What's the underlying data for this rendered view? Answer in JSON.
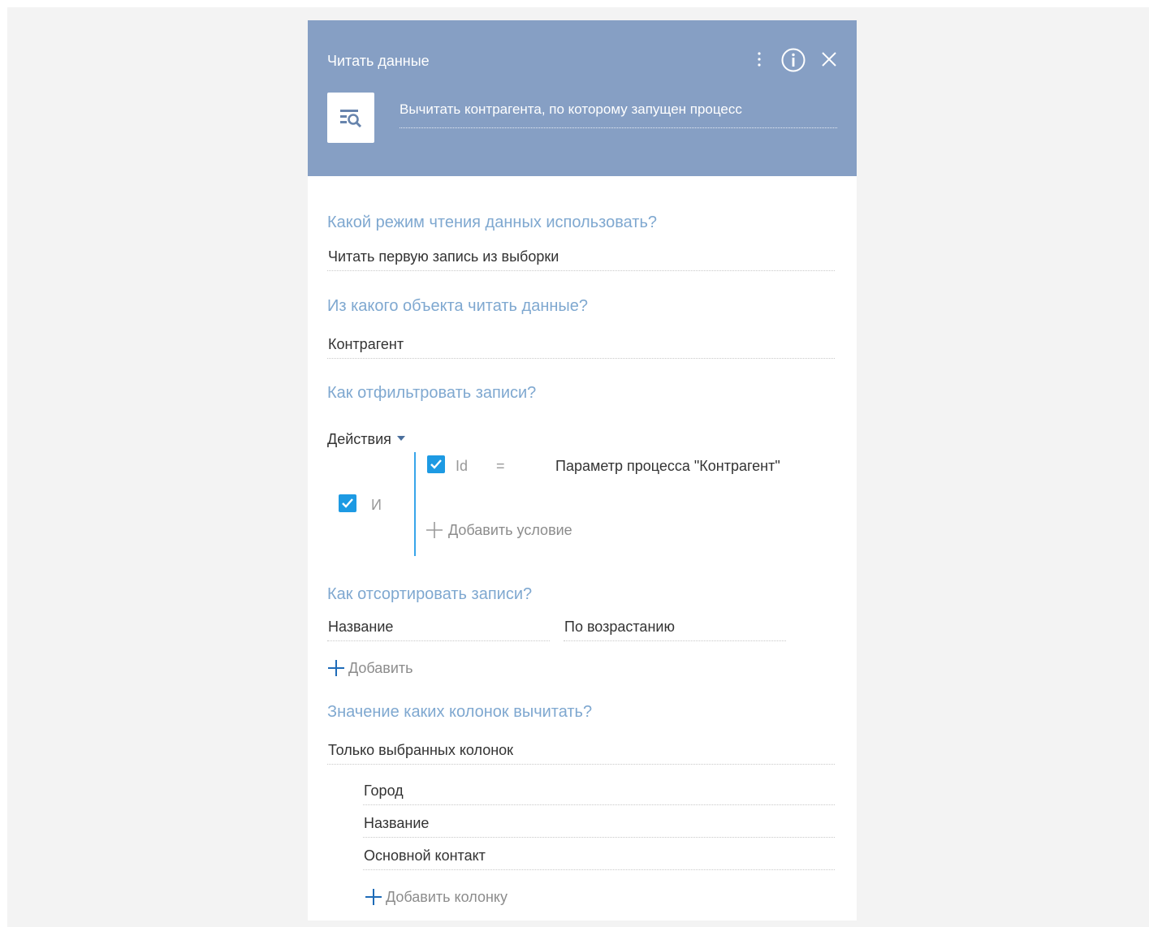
{
  "header": {
    "title": "Читать данные",
    "description": "Вычитать контрагента, по которому запущен процесс"
  },
  "mode": {
    "question": "Какой режим чтения данных использовать?",
    "value": "Читать первую запись из выборки"
  },
  "object": {
    "question": "Из какого объекта читать данные?",
    "value": "Контрагент"
  },
  "filter": {
    "question": "Как отфильтровать записи?",
    "actions_label": "Действия",
    "group_operator": "И",
    "condition": {
      "column": "Id",
      "operator": "=",
      "value": "Параметр процесса \"Контрагент\""
    },
    "add_condition_label": "Добавить условие"
  },
  "sort": {
    "question": "Как отсортировать записи?",
    "column": "Название",
    "direction": "По возрастанию",
    "add_label": "Добавить"
  },
  "columns": {
    "question": "Значение каких колонок вычитать?",
    "mode": "Только выбранных колонок",
    "items": [
      "Город",
      "Название",
      "Основной контакт"
    ],
    "add_label": "Добавить колонку"
  },
  "colors": {
    "header_bg": "#869fc4",
    "question_text": "#7fa8d0",
    "checkbox": "#1d9ae3",
    "accent": "#1e6bb8"
  },
  "icons": {
    "header_menu": "more-vertical-icon",
    "header_info": "info-icon",
    "header_close": "close-icon",
    "element": "read-data-icon"
  }
}
